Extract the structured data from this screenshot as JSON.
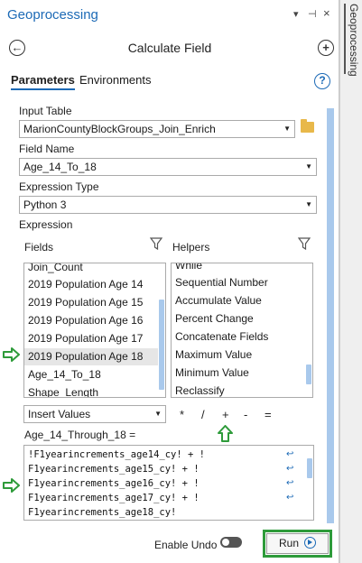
{
  "pane": {
    "title": "Geoprocessing",
    "controls": [
      "▾",
      "⊣",
      "×"
    ]
  },
  "side_tab": {
    "label": "Geoprocessing"
  },
  "tool": {
    "title": "Calculate Field",
    "back_symbol": "←",
    "add_symbol": "+"
  },
  "tabs": [
    {
      "label": "Parameters",
      "active": true
    },
    {
      "label": "Environments",
      "active": false
    }
  ],
  "help": {
    "symbol": "?"
  },
  "input_table": {
    "label": "Input Table",
    "value": "MarionCountyBlockGroups_Join_Enrich"
  },
  "field_name": {
    "label": "Field Name",
    "value": "Age_14_To_18"
  },
  "expression_type": {
    "label": "Expression Type",
    "value": "Python 3"
  },
  "expression": {
    "label": "Expression"
  },
  "fields": {
    "label": "Fields",
    "items": [
      "Join_Count",
      "2019 Population Age 14",
      "2019 Population Age 15",
      "2019 Population Age 16",
      "2019 Population Age 17",
      "2019 Population Age 18",
      "Age_14_To_18",
      "Shape_Length"
    ],
    "selected": "2019 Population Age 18"
  },
  "helpers": {
    "label": "Helpers",
    "items": [
      "While",
      "Sequential Number",
      "Accumulate Value",
      "Percent Change",
      "Concatenate Fields",
      "Maximum Value",
      "Minimum Value",
      "Reclassify"
    ]
  },
  "insert_values": {
    "value": "Insert Values"
  },
  "operators": [
    "*",
    "/",
    "+",
    "-",
    "="
  ],
  "expression_field": {
    "label": "Age_14_Through_18 =",
    "lines": [
      "!F1yearincrements_age14_cy! + !",
      "F1yearincrements_age15_cy! + !",
      "F1yearincrements_age16_cy! + !",
      "F1yearincrements_age17_cy! + !",
      "F1yearincrements_age18_cy!"
    ]
  },
  "footer": {
    "enable_undo_label": "Enable Undo",
    "enable_undo_on": false,
    "run_label": "Run"
  },
  "colors": {
    "accent": "#1c6ab6",
    "highlight": "#2e9b3a",
    "scrollbar": "#a9c9ec"
  }
}
